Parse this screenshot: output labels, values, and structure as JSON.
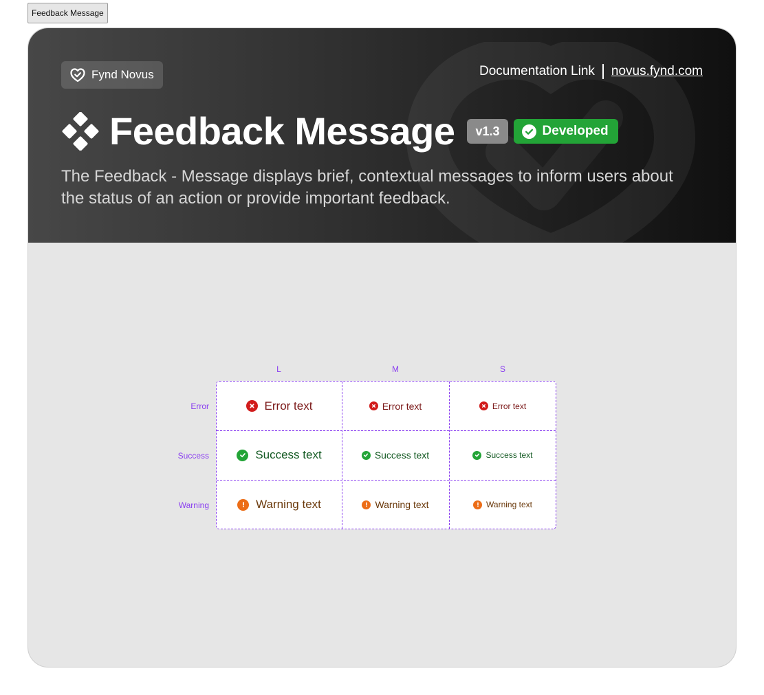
{
  "frame_tag": "Feedback Message",
  "header": {
    "brand": "Fynd Novus",
    "doc_link_label": "Documentation Link",
    "doc_url": "novus.fynd.com",
    "title": "Feedback Message",
    "version": "v1.3",
    "status": "Developed",
    "description": "The Feedback - Message displays brief, contextual messages to inform users about the status of an action or provide important feedback."
  },
  "matrix": {
    "columns": [
      "L",
      "M",
      "S"
    ],
    "rows": [
      {
        "label": "Error",
        "text": "Error text"
      },
      {
        "label": "Success",
        "text": "Success text"
      },
      {
        "label": "Warning",
        "text": "Warning text"
      }
    ]
  },
  "colors": {
    "accent": "#8a3ff0",
    "error": "#d11c1c",
    "success": "#23a437",
    "warning": "#ec6d17"
  },
  "icons": {
    "brand": "heart-check-icon",
    "title": "diamond-cluster-icon",
    "status": "check-circle-icon",
    "error": "close-circle-icon",
    "success": "check-circle-icon",
    "warning": "alert-circle-icon"
  }
}
